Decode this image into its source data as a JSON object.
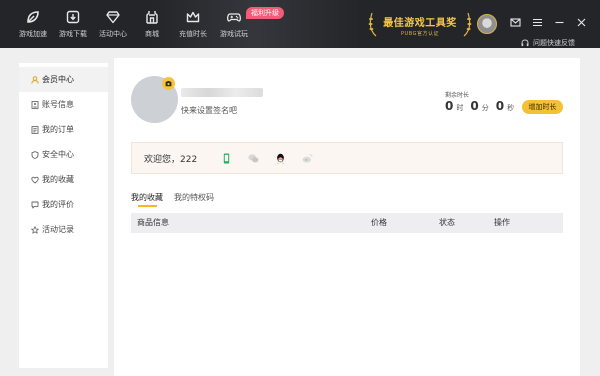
{
  "nav": [
    {
      "label": "游戏加速",
      "icon": "leaf-icon"
    },
    {
      "label": "游戏下载",
      "icon": "download-icon"
    },
    {
      "label": "活动中心",
      "icon": "diamond-icon"
    },
    {
      "label": "商城",
      "icon": "store-icon"
    },
    {
      "label": "充值时长",
      "icon": "crown-icon"
    },
    {
      "label": "游戏试玩",
      "icon": "gamepad-icon"
    }
  ],
  "nav_badge": "福利升级",
  "award": {
    "title": "最佳游戏工具奖",
    "subtitle": "PUBG官方认证"
  },
  "feedback": "问题快速反馈",
  "sidebar": [
    {
      "label": "会员中心",
      "icon": "user-icon",
      "active": true
    },
    {
      "label": "账号信息",
      "icon": "id-card-icon"
    },
    {
      "label": "我的订单",
      "icon": "order-icon"
    },
    {
      "label": "安全中心",
      "icon": "shield-icon"
    },
    {
      "label": "我的收藏",
      "icon": "heart-icon"
    },
    {
      "label": "我的评价",
      "icon": "comment-icon"
    },
    {
      "label": "活动记录",
      "icon": "star-icon"
    }
  ],
  "profile": {
    "signature_placeholder": "快来设置签名吧"
  },
  "remaining": {
    "label": "剩余时长",
    "hours": "0",
    "hours_unit": "时",
    "minutes": "0",
    "minutes_unit": "分",
    "seconds": "0",
    "seconds_unit": "秒",
    "add_button": "增加时长"
  },
  "welcome": {
    "text": "欢迎您，222"
  },
  "tabs": [
    "我的收藏",
    "我的特权码"
  ],
  "table": {
    "columns": [
      "商品信息",
      "价格",
      "状态",
      "操作"
    ]
  },
  "colors": {
    "topbar": "#232529",
    "accent": "#f5c134",
    "badge": "#f35b78",
    "award": "#f6c74a"
  }
}
